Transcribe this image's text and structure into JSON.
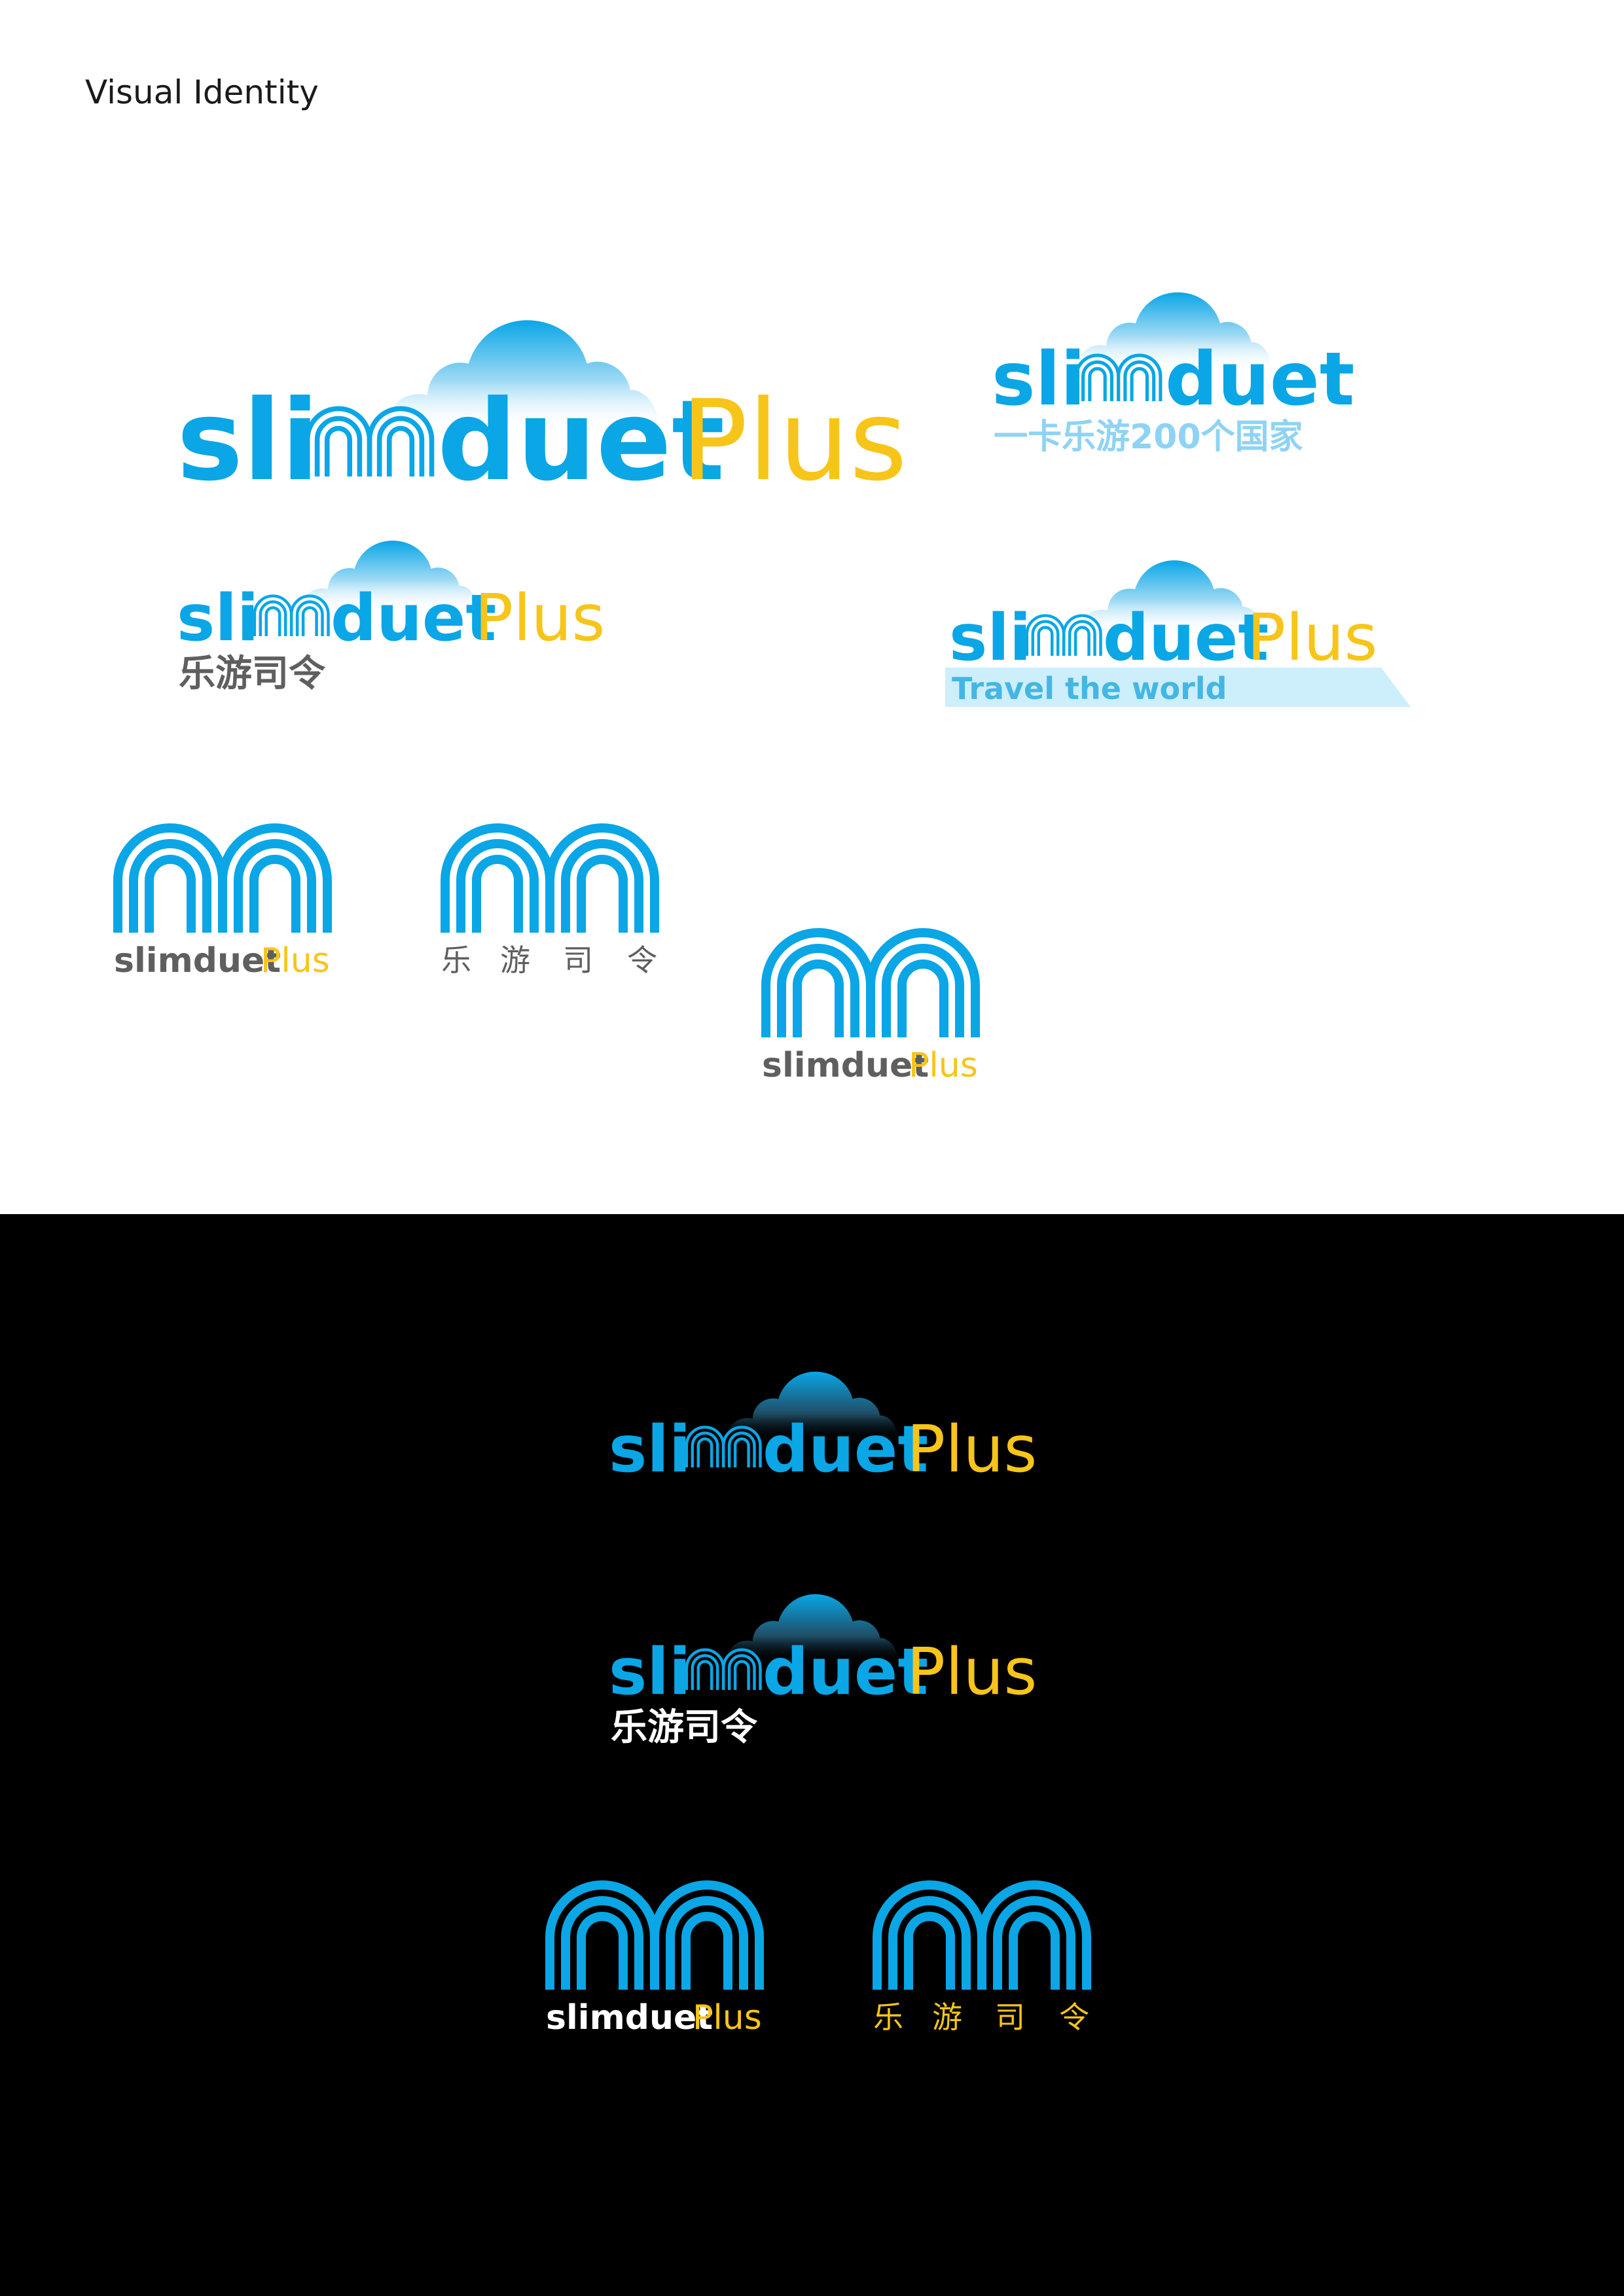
{
  "page": {
    "title": "Visual Identity"
  },
  "brand": {
    "prefix": "sli",
    "name_rest": "duet",
    "plus": "Plus",
    "monogram_name": "slimduet",
    "chinese_name": "乐游司令",
    "chinese_chars": [
      "乐",
      "游",
      "司",
      "令"
    ],
    "slogan_cn": "一卡乐游200个国家",
    "tagline_en": "Travel the world"
  },
  "colors": {
    "brand_blue": "#0aa6e6",
    "brand_yellow": "#f7c51a",
    "grey_text": "#5f5f5f",
    "light_blue_text": "#8fd3f4",
    "tagline_banner": "#cdeefb",
    "tagline_text": "#44b6e3",
    "white_bg": "#ffffff",
    "black_bg": "#000000"
  },
  "icons": [
    "cloud-icon",
    "m-arch-monogram-icon"
  ]
}
